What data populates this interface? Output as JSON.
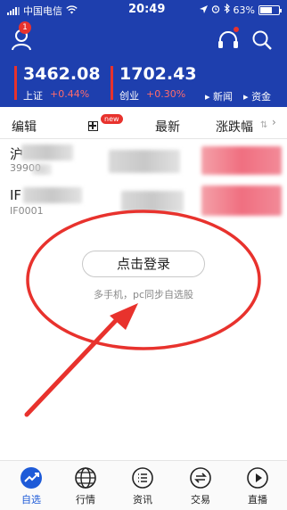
{
  "status_bar": {
    "carrier": "中国电信",
    "time": "20:49",
    "battery": "63%",
    "battery_level": 0.63
  },
  "header": {
    "notification_count": "1"
  },
  "indices": [
    {
      "value": "3462.08",
      "name": "上证",
      "change": "+0.44%"
    },
    {
      "value": "1702.43",
      "name": "创业",
      "change": "+0.30%"
    }
  ],
  "links": [
    {
      "label": "新闻"
    },
    {
      "label": "资金"
    }
  ],
  "tabs": {
    "edit": "编辑",
    "new_badge": "new",
    "newest": "最新",
    "change_rank": "涨跌幅"
  },
  "watchlist": [
    {
      "name": "沪",
      "code": "39900"
    },
    {
      "name": "IF",
      "code": "IF0001"
    }
  ],
  "empty_state": {
    "login_button": "点击登录",
    "sync_hint": "多手机，pc同步自选股"
  },
  "bottom_nav": [
    {
      "label": "自选",
      "icon": "trend-icon",
      "active": true
    },
    {
      "label": "行情",
      "icon": "globe-icon"
    },
    {
      "label": "资讯",
      "icon": "list-icon"
    },
    {
      "label": "交易",
      "icon": "trade-icon"
    },
    {
      "label": "直播",
      "icon": "play-icon"
    }
  ],
  "colors": {
    "brand_blue": "#1e3fae",
    "up_red": "#e8322d",
    "active_tab": "#1e5bd8",
    "annotation_red": "#e8322d"
  }
}
